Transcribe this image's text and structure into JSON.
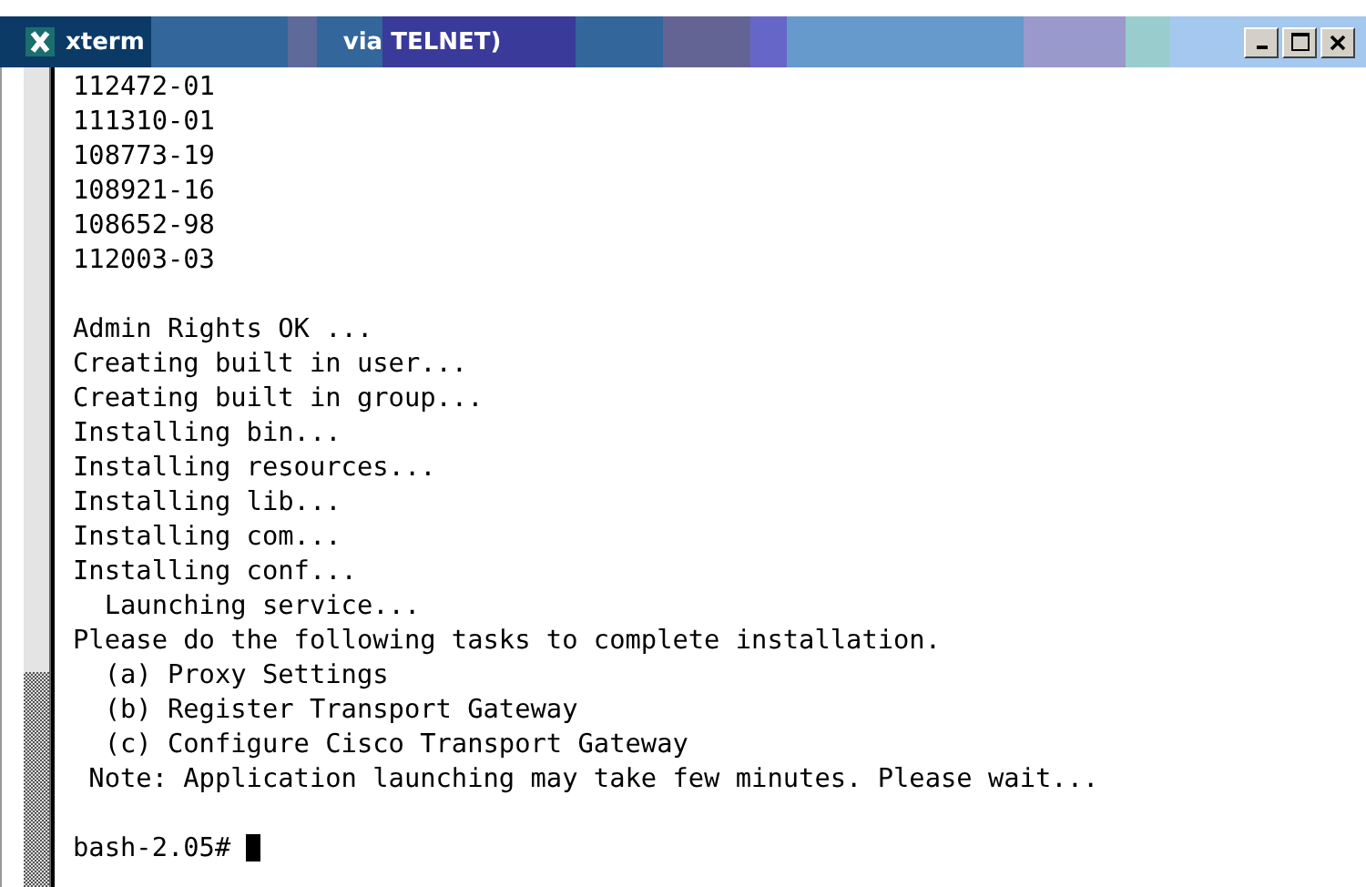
{
  "window": {
    "title_parts": [
      "xterm",
      "via TELNET)"
    ]
  },
  "terminal": {
    "blocks": [
      [
        "112472-01",
        "111310-01",
        "108773-19",
        "108921-16",
        "108652-98",
        "112003-03"
      ],
      [
        "Admin Rights OK ...",
        "Creating built in user...",
        "Creating built in group...",
        "Installing bin...",
        "Installing resources...",
        "Installing lib...",
        "Installing com...",
        "Installing conf...",
        "  Launching service...",
        "Please do the following tasks to complete installation.",
        "  (a) Proxy Settings",
        "  (b) Register Transport Gateway",
        "  (c) Configure Cisco Transport Gateway",
        " Note: Application launching may take few minutes. Please wait..."
      ]
    ],
    "prompt": "bash-2.05#"
  }
}
